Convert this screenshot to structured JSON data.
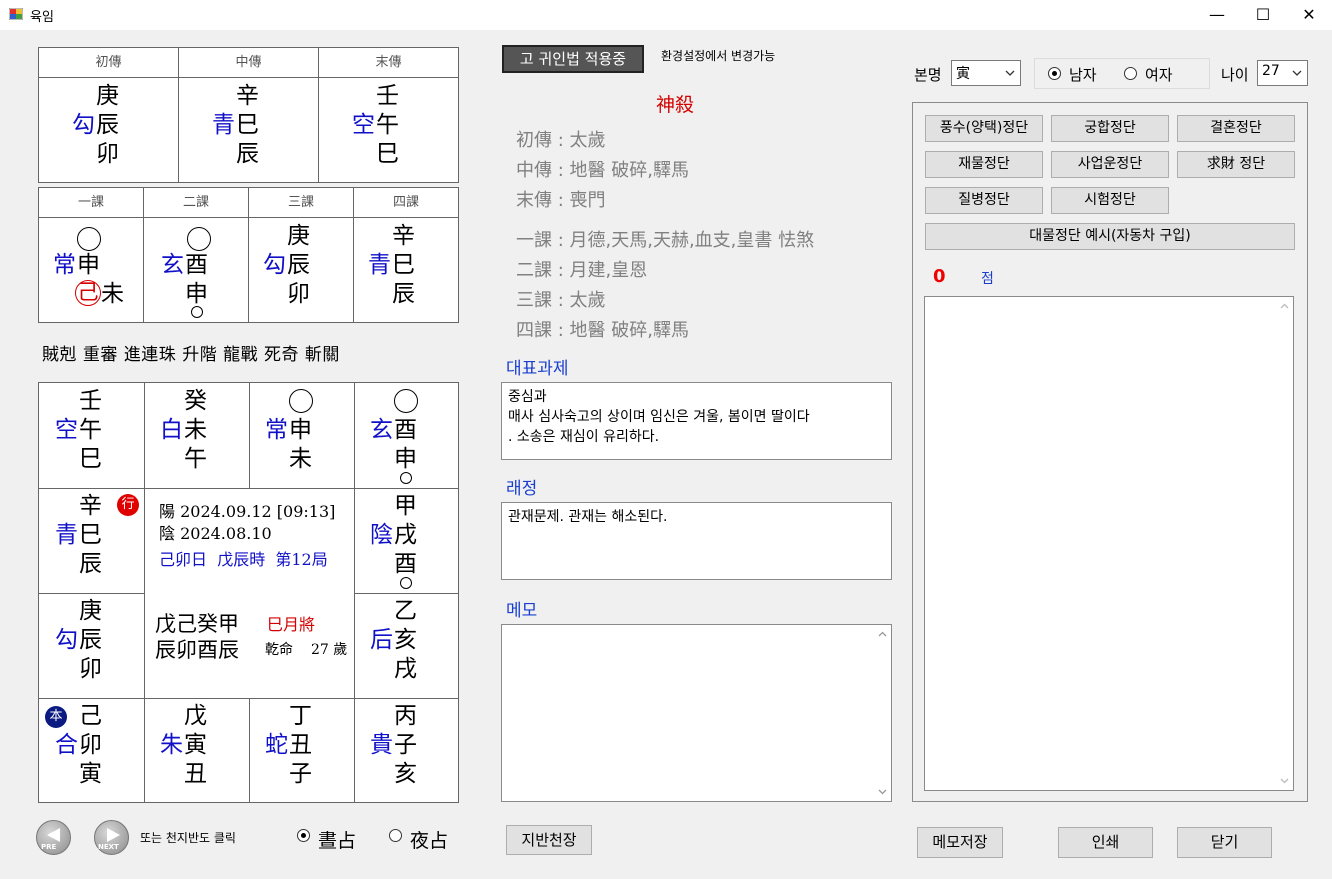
{
  "window": {
    "title": "육임",
    "min": "—",
    "max": "☐",
    "close": "✕"
  },
  "sanchuan": {
    "headers": [
      "初傳",
      "中傳",
      "末傳"
    ],
    "cols": [
      {
        "god": "勾",
        "top": "庚",
        "mid": "辰",
        "bot": "卯"
      },
      {
        "god": "青",
        "top": "辛",
        "mid": "巳",
        "bot": "辰"
      },
      {
        "god": "空",
        "top": "壬",
        "mid": "午",
        "bot": "巳"
      }
    ]
  },
  "sike": {
    "headers": [
      "一課",
      "二課",
      "三課",
      "四課"
    ],
    "cols": [
      {
        "god": "常",
        "top": "",
        "mid": "申",
        "bot": "未",
        "botpre": "己"
      },
      {
        "god": "玄",
        "top": "",
        "mid": "酉",
        "bot": "申"
      },
      {
        "god": "勾",
        "top": "庚",
        "mid": "辰",
        "bot": "卯"
      },
      {
        "god": "青",
        "top": "辛",
        "mid": "巳",
        "bot": "辰"
      }
    ]
  },
  "kelei": "賊剋 重審 進連珠 升階 龍戰 死奇 斬關",
  "board": {
    "r0": [
      {
        "god": "空",
        "top": "壬",
        "mid": "午",
        "bot": "巳"
      },
      {
        "god": "白",
        "top": "癸",
        "mid": "未",
        "bot": "午"
      },
      {
        "god": "常",
        "top": "",
        "mid": "申",
        "bot": "未"
      },
      {
        "god": "玄",
        "top": "",
        "mid": "酉",
        "bot": "申"
      }
    ],
    "l1": {
      "god": "青",
      "top": "辛",
      "mid": "巳",
      "bot": "辰",
      "badge": "行"
    },
    "l2": {
      "god": "勾",
      "top": "庚",
      "mid": "辰",
      "bot": "卯"
    },
    "r1": {
      "god": "陰",
      "top": "甲",
      "mid": "戌",
      "bot": "酉"
    },
    "r2": {
      "god": "后",
      "top": "乙",
      "mid": "亥",
      "bot": "戌"
    },
    "r3": [
      {
        "god": "合",
        "top": "己",
        "mid": "卯",
        "bot": "寅",
        "badge": "本"
      },
      {
        "god": "朱",
        "top": "戊",
        "mid": "寅",
        "bot": "丑"
      },
      {
        "god": "蛇",
        "top": "丁",
        "mid": "丑",
        "bot": "子"
      },
      {
        "god": "貴",
        "top": "丙",
        "mid": "子",
        "bot": "亥"
      }
    ],
    "center": {
      "solar": "陽 2024.09.12 [09:13]",
      "lunar": "陰 2024.08.10",
      "day": "己卯日",
      "hour": "戊辰時",
      "ju": "第12局",
      "pillars_top": "戊己癸甲",
      "pillars_bot": "辰卯酉辰",
      "yuejiang": "巳月將",
      "ming": "乾命",
      "age": "27 歲"
    }
  },
  "nav": {
    "prev": "PRE",
    "next": "NEXT",
    "hint": "또는 천지반도 클릭",
    "day_label": "晝占",
    "night_label": "夜占"
  },
  "mid": {
    "guiin_button": "고 귀인법 적용중",
    "guiin_hint": "환경설정에서 변경가능",
    "shensha_title": "神殺",
    "lines": [
      "初傳 : 太歲",
      "中傳 :  地醫 破碎,驛馬",
      "末傳 : 喪門",
      "一課 :  月德,天馬,天赫,血支,皇書 怯煞",
      "二課 :  月建,皇恩",
      "三課 : 太歲",
      "四課 :  地醫 破碎,驛馬"
    ],
    "rep_title": "대표과제",
    "rep_lines": [
      "중심과",
      "매사 심사숙고의 상이며 임신은 겨울, 봄이면 딸이다",
      ". 소송은 재심이 유리하다."
    ],
    "lai_title": "래정",
    "lai_text": "관재문제. 관재는 해소된다.",
    "memo_title": "메모",
    "jiban_button": "지반천장"
  },
  "right": {
    "benming_label": "본명",
    "benming_value": "寅",
    "male": "남자",
    "female": "여자",
    "age_label": "나이",
    "age_value": "27",
    "buttons": [
      "풍수(양택)정단",
      "궁합정단",
      "결혼정단",
      "재물정단",
      "사업운정단",
      "求財 정단",
      "질병정단",
      "시험정단"
    ],
    "wide_button": "대물정단 예시(자동차 구입)",
    "score": "0",
    "score_unit": "점",
    "save_button": "메모저장",
    "print_button": "인쇄",
    "close_button": "닫기"
  }
}
